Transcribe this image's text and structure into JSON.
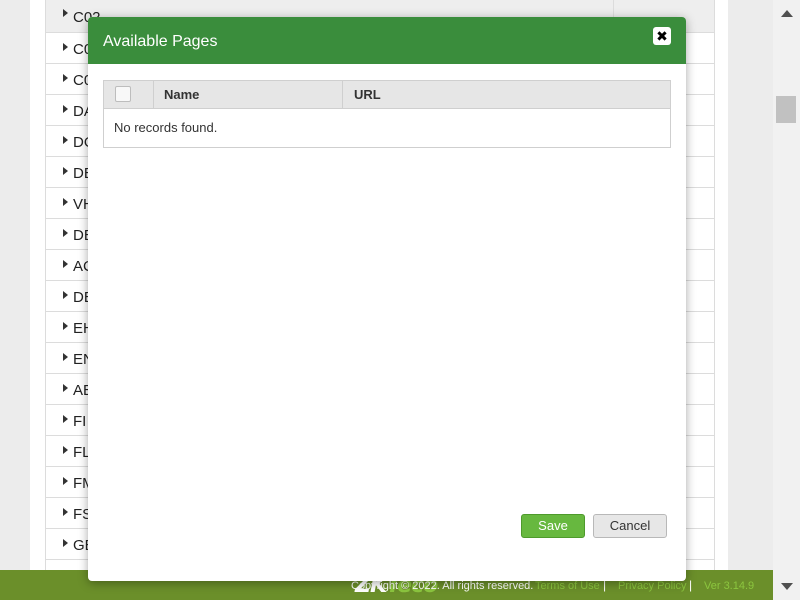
{
  "background": {
    "rows": [
      {
        "label": "C02"
      },
      {
        "label": "C0"
      },
      {
        "label": "C0"
      },
      {
        "label": "DA"
      },
      {
        "label": "DO"
      },
      {
        "label": "DE"
      },
      {
        "label": "VH"
      },
      {
        "label": "DE"
      },
      {
        "label": "AC"
      },
      {
        "label": "DE"
      },
      {
        "label": "EH"
      },
      {
        "label": "EN"
      },
      {
        "label": "AE"
      },
      {
        "label": "FI"
      },
      {
        "label": "FL"
      },
      {
        "label": "FM"
      },
      {
        "label": "FS"
      },
      {
        "label": "GE"
      },
      {
        "label": ""
      }
    ]
  },
  "modal": {
    "title": "Available Pages",
    "close_glyph": "✖",
    "columns": {
      "name": "Name",
      "url": "URL"
    },
    "empty_message": "No records found.",
    "save_label": "Save",
    "cancel_label": "Cancel"
  },
  "footer": {
    "logo_zk": "ZK",
    "logo_teco": "Teco",
    "copyright": "Copyright © 2022. All rights reserved.",
    "terms": "Terms of Use",
    "privacy": "Privacy Policy",
    "version": "Ver 3.14.9",
    "separator": "|"
  },
  "colors": {
    "header_green": "#3a8d3c",
    "save_green": "#67b83f",
    "footer_green": "#6b8f2a",
    "link_green": "#8cc63f"
  }
}
